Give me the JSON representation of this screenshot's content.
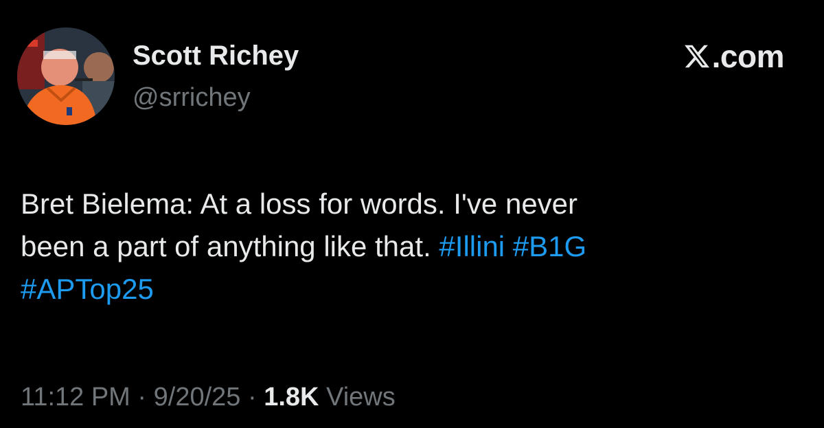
{
  "author": {
    "display_name": "Scott Richey",
    "handle": "@srrichey",
    "avatar_icon": "profile-photo"
  },
  "brand": {
    "logo_icon": "x-logo-icon",
    "domain_suffix": ".com"
  },
  "tweet": {
    "line1_text": "Bret Bielema: At a loss for words. I've never",
    "line2_text": "been a part of anything like that.",
    "hashtags": [
      "#Illini",
      "#B1G",
      "#APTop25"
    ]
  },
  "meta": {
    "time": "11:12 PM",
    "separator": "·",
    "date": "9/20/25",
    "views_count": "1.8K",
    "views_label": "Views"
  },
  "colors": {
    "background": "#000000",
    "text_primary": "#e7e9ea",
    "text_secondary": "#71767b",
    "hashtag": "#1d9bf0"
  }
}
